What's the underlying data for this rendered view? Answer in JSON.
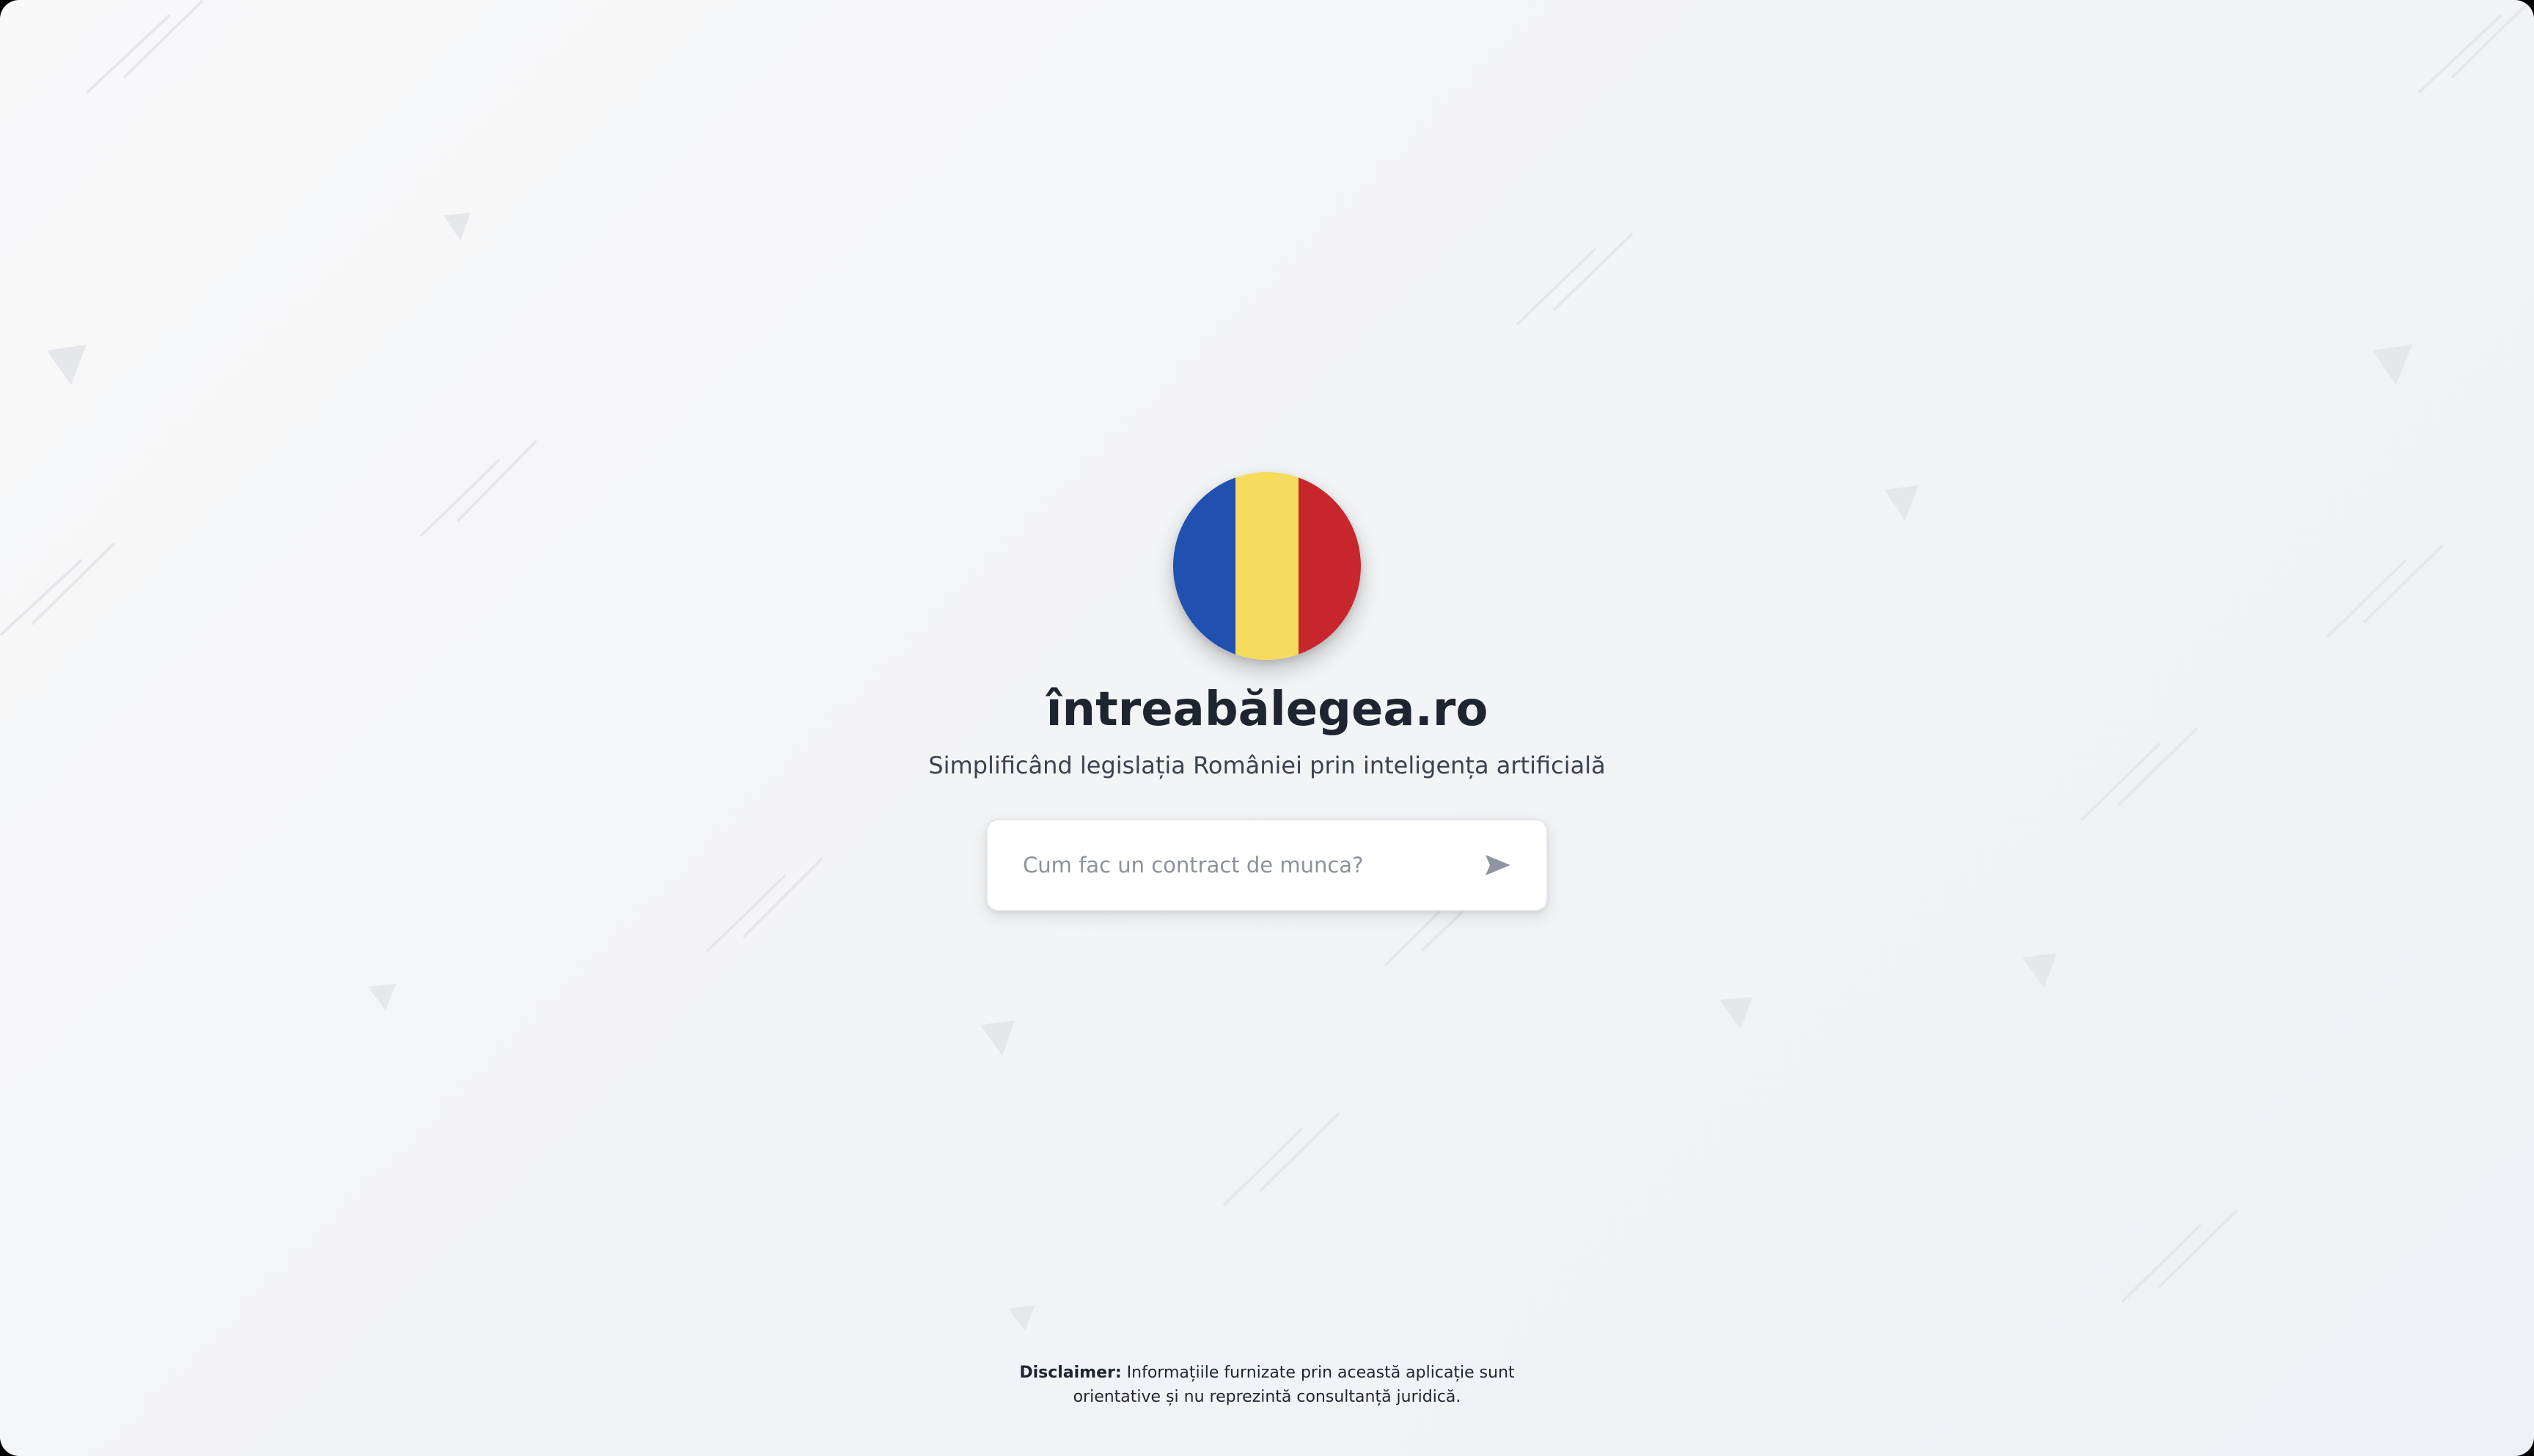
{
  "app": {
    "brand_colors": {
      "blue": "#2151b0",
      "yellow": "#f7db5c",
      "red": "#c8262d"
    }
  },
  "logo": {
    "icon": "romanian-flag-icon"
  },
  "header": {
    "title": "întreabălegea.ro",
    "subtitle": "Simplificând legislația României prin inteligența artificială"
  },
  "search": {
    "placeholder": "Cum fac un contract de munca?",
    "value": "",
    "send_icon": "send-arrow-icon"
  },
  "footer": {
    "disclaimer_label": "Disclaimer:",
    "disclaimer_line1": "Informațiile furnizate prin această aplicație sunt",
    "disclaimer_line2": "orientative și nu reprezintă consultanță juridică."
  }
}
